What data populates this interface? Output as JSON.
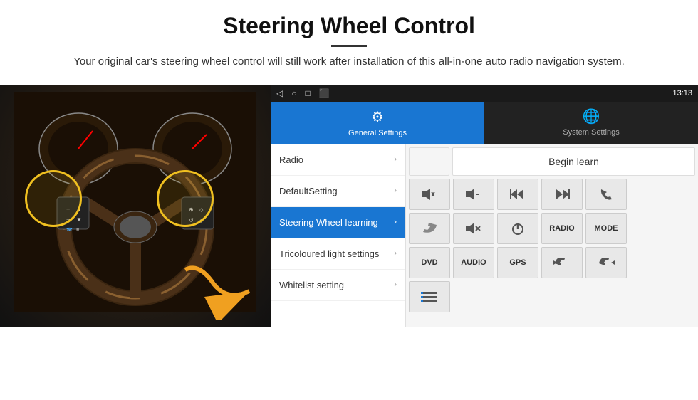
{
  "header": {
    "title": "Steering Wheel Control",
    "divider": true,
    "subtitle": "Your original car's steering wheel control will still work after installation of this all-in-one auto radio navigation system."
  },
  "status_bar": {
    "time": "13:13",
    "icons": [
      "◁",
      "○",
      "□",
      "⬛"
    ]
  },
  "tabs": [
    {
      "id": "general",
      "label": "General Settings",
      "icon": "⚙",
      "active": true
    },
    {
      "id": "system",
      "label": "System Settings",
      "icon": "🌐",
      "active": false
    }
  ],
  "menu_items": [
    {
      "label": "Radio",
      "active": false
    },
    {
      "label": "DefaultSetting",
      "active": false
    },
    {
      "label": "Steering Wheel learning",
      "active": true
    },
    {
      "label": "Tricoloured light settings",
      "active": false
    },
    {
      "label": "Whitelist setting",
      "active": false
    }
  ],
  "right_panel": {
    "begin_learn_label": "Begin learn",
    "rows": [
      [
        {
          "type": "icon",
          "symbol": "🔊+",
          "label": "vol-up"
        },
        {
          "type": "icon",
          "symbol": "🔊−",
          "label": "vol-down"
        },
        {
          "type": "icon",
          "symbol": "⏮",
          "label": "prev"
        },
        {
          "type": "icon",
          "symbol": "⏭",
          "label": "next"
        },
        {
          "type": "icon",
          "symbol": "📞",
          "label": "phone"
        }
      ],
      [
        {
          "type": "icon",
          "symbol": "↩",
          "label": "hang-up"
        },
        {
          "type": "icon",
          "symbol": "🔇",
          "label": "mute"
        },
        {
          "type": "icon",
          "symbol": "⏻",
          "label": "power"
        },
        {
          "type": "text",
          "symbol": "RADIO",
          "label": "radio"
        },
        {
          "type": "text",
          "symbol": "MODE",
          "label": "mode"
        }
      ],
      [
        {
          "type": "text",
          "symbol": "DVD",
          "label": "dvd"
        },
        {
          "type": "text",
          "symbol": "AUDIO",
          "label": "audio"
        },
        {
          "type": "text",
          "symbol": "GPS",
          "label": "gps"
        },
        {
          "type": "icon",
          "symbol": "📱⏮",
          "label": "phone-prev"
        },
        {
          "type": "icon",
          "symbol": "📱⏭",
          "label": "phone-next"
        }
      ]
    ]
  }
}
